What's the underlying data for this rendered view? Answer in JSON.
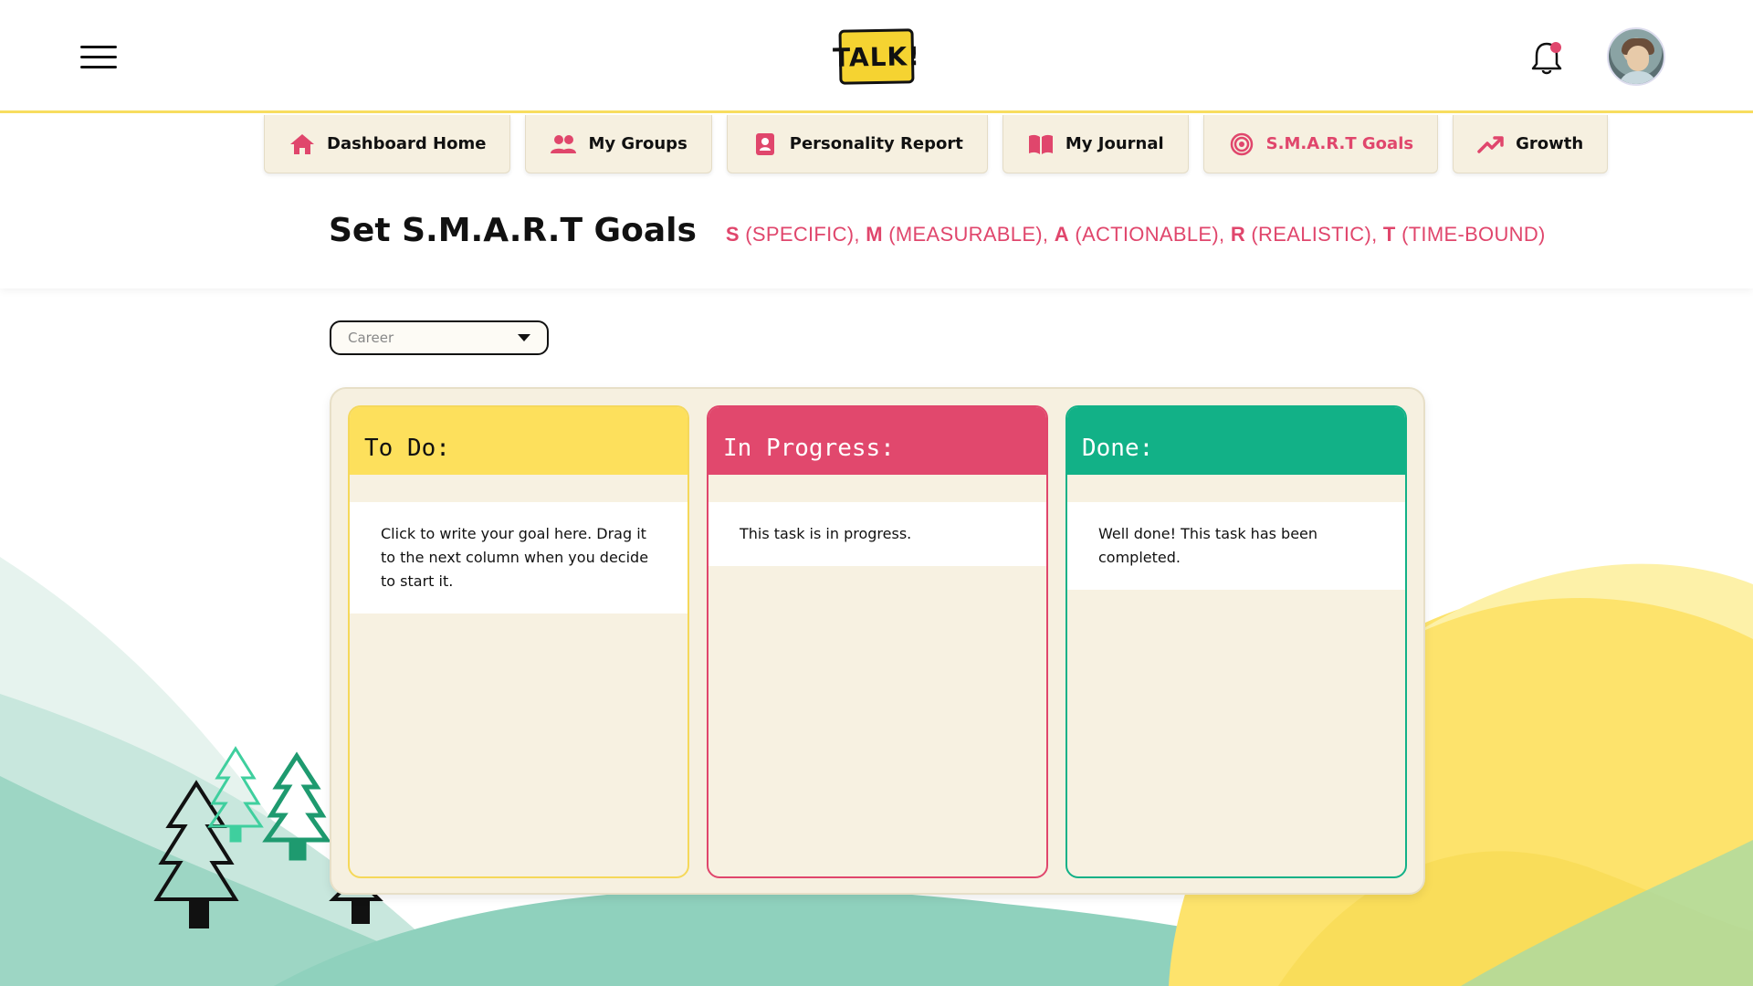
{
  "header": {
    "menu_icon": "hamburger-menu-icon",
    "logo_text": "TALK!",
    "notification_icon": "bell-icon",
    "avatar_icon": "user-avatar"
  },
  "nav": {
    "tabs": [
      {
        "label": "Dashboard Home",
        "icon": "home-icon",
        "active": false
      },
      {
        "label": "My Groups",
        "icon": "users-icon",
        "active": false
      },
      {
        "label": "Personality Report",
        "icon": "id-card-icon",
        "active": false
      },
      {
        "label": "My Journal",
        "icon": "book-open-icon",
        "active": false
      },
      {
        "label": "S.M.A.R.T Goals",
        "icon": "target-icon",
        "active": true
      },
      {
        "label": "Growth",
        "icon": "trending-up-icon",
        "active": false
      }
    ]
  },
  "page": {
    "title": "Set S.M.A.R.T Goals",
    "subtitle_parts": [
      {
        "letter": "S",
        "rest": " (SPECIFIC), "
      },
      {
        "letter": "M",
        "rest": " (MEASURABLE), "
      },
      {
        "letter": "A",
        "rest": " (ACTIONABLE), "
      },
      {
        "letter": "R",
        "rest": " (REALISTIC), "
      },
      {
        "letter": "T",
        "rest": " (TIME-BOUND)"
      }
    ]
  },
  "filter": {
    "selected": "Career"
  },
  "board": {
    "columns": [
      {
        "title": "To Do:",
        "cards": [
          "Click to write your goal here. Drag it to the next column when you decide to start it."
        ]
      },
      {
        "title": "In Progress:",
        "cards": [
          "This task is in progress."
        ]
      },
      {
        "title": "Done:",
        "cards": [
          "Well done! This task has been completed."
        ]
      }
    ]
  },
  "colors": {
    "accent_pink": "#e0466c",
    "accent_yellow": "#fde05c",
    "accent_green": "#12b187",
    "board_bg": "#f6f0e0"
  }
}
